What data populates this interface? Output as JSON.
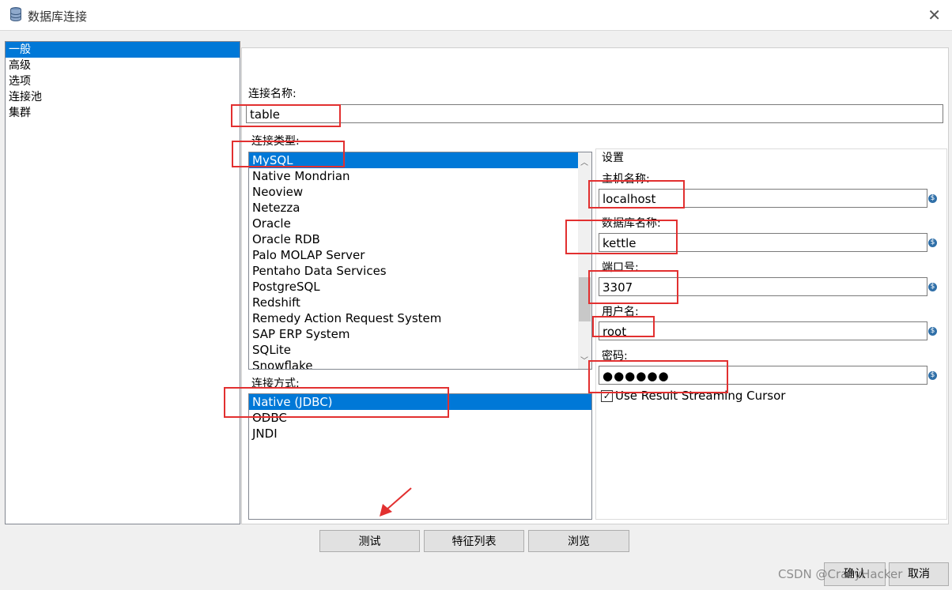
{
  "window": {
    "title": "数据库连接"
  },
  "nav": {
    "items": [
      "一般",
      "高级",
      "选项",
      "连接池",
      "集群"
    ],
    "selected": 0
  },
  "connection_name": {
    "label": "连接名称:",
    "value": "table"
  },
  "connection_type": {
    "label": "连接类型:",
    "items": [
      "MySQL",
      "Native Mondrian",
      "Neoview",
      "Netezza",
      "Oracle",
      "Oracle RDB",
      "Palo MOLAP Server",
      "Pentaho Data Services",
      "PostgreSQL",
      "Redshift",
      "Remedy Action Request System",
      "SAP ERP System",
      "SQLite",
      "Snowflake"
    ],
    "selected": 0
  },
  "access": {
    "label": "连接方式:",
    "items": [
      "Native (JDBC)",
      "ODBC",
      "JNDI"
    ],
    "selected": 0
  },
  "settings": {
    "title": "设置",
    "host_label": "主机名称:",
    "host_value": "localhost",
    "db_label": "数据库名称:",
    "db_value": "kettle",
    "port_label": "端口号:",
    "port_value": "3307",
    "user_label": "用户名:",
    "user_value": "root",
    "password_label": "密码:",
    "password_value": "●●●●●●",
    "checkbox_label": "Use Result Streaming Cursor",
    "checkbox_checked": true
  },
  "buttons": {
    "test": "测试",
    "features": "特征列表",
    "browse": "浏览",
    "ok": "确认",
    "cancel": "取消"
  },
  "watermark": "CSDN @CrazyHacker"
}
